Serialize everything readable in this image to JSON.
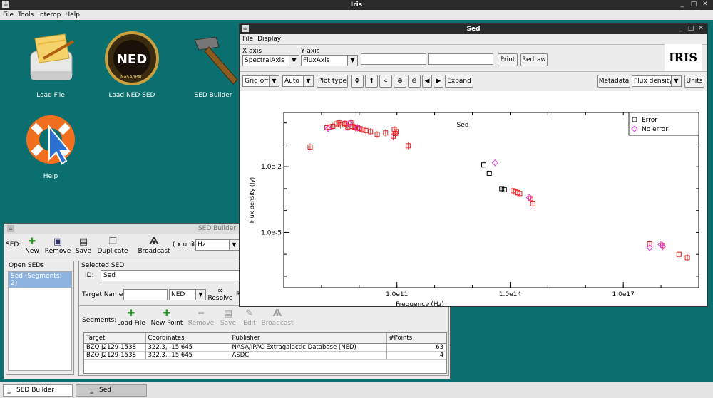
{
  "app": {
    "title": "Iris",
    "menu": [
      "File",
      "Tools",
      "Interop",
      "Help"
    ]
  },
  "desktop": {
    "icons": [
      {
        "label": "Load File"
      },
      {
        "label": "Load NED SED"
      },
      {
        "label": "SED Builder"
      },
      {
        "label": "Help"
      }
    ],
    "ned_text": "NED",
    "ned_ring": "NASA/IPAC"
  },
  "builder": {
    "title": "SED Builder",
    "sed_label": "SED:",
    "toolbar": [
      {
        "label": "New"
      },
      {
        "label": "Remove"
      },
      {
        "label": "Save"
      },
      {
        "label": "Duplicate"
      },
      {
        "label": "Broadcast"
      }
    ],
    "xunit_label": "( x unit",
    "xunit_value": "Hz",
    "open_seds_title": "Open SEDs",
    "open_seds": [
      "Sed (Segments: 2)"
    ],
    "selected_title": "Selected SED",
    "id_label": "ID:",
    "id_value": "Sed",
    "target_label": "Target Name:",
    "target_source": "NED",
    "resolve_label": "Resolve",
    "r_label": "R",
    "segments_label": "Segments:",
    "seg_toolbar": [
      {
        "label": "Load File"
      },
      {
        "label": "New Point"
      },
      {
        "label": "Remove"
      },
      {
        "label": "Save"
      },
      {
        "label": "Edit"
      },
      {
        "label": "Broadcast"
      }
    ],
    "table": {
      "headers": [
        "Target",
        "Coordinates",
        "Publisher",
        "#Points"
      ],
      "rows": [
        [
          "BZQ J2129-1538",
          "322.3, -15.645",
          "NASA/IPAC Extragalactic Database (NED)",
          "63"
        ],
        [
          "BZQ J2129-1538",
          "322.3, -15.645",
          "ASDC",
          "4"
        ]
      ]
    }
  },
  "sed": {
    "title": "Sed",
    "menu": [
      "File",
      "Display"
    ],
    "xaxis_label": "X axis",
    "xaxis_value": "SpectralAxis",
    "yaxis_label": "Y axis",
    "yaxis_value": "FluxAxis",
    "print_label": "Print",
    "redraw_label": "Redraw",
    "logo_text": "IRIS",
    "grid_value": "Grid off",
    "auto_value": "Auto",
    "plottype_label": "Plot type",
    "expand_label": "Expand",
    "metadata_label": "Metadata",
    "flux_value": "Flux density",
    "units_label": "Units"
  },
  "chart_data": {
    "type": "scatter",
    "title": "Sed",
    "xlabel": "Frequency (Hz)",
    "ylabel": "Flux density (Jy)",
    "xscale": "log",
    "yscale": "log",
    "xlim": [
      100000000.0,
      1e+19
    ],
    "ylim": [
      3e-08,
      3
    ],
    "xticks": [
      {
        "v": 100000000000.0,
        "label": "1.0e11"
      },
      {
        "v": 100000000000000.0,
        "label": "1.0e14"
      },
      {
        "v": 1e+17,
        "label": "1.0e17"
      }
    ],
    "yticks": [
      {
        "v": 0.01,
        "label": "1.0e-2"
      },
      {
        "v": 1e-05,
        "label": "1.0e-5"
      }
    ],
    "legend": {
      "placement": "top-right",
      "entries": [
        {
          "name": "Error",
          "marker": "square",
          "color": "#000000"
        },
        {
          "name": "No error",
          "marker": "diamond",
          "color": "#e040e0"
        }
      ]
    },
    "series": [
      {
        "name": "Error",
        "marker": "square",
        "color": "#e02020",
        "points": [
          [
            500000000.0,
            0.08
          ],
          [
            1400000000.0,
            0.6
          ],
          [
            1600000000.0,
            0.65
          ],
          [
            2000000000.0,
            0.7
          ],
          [
            2500000000.0,
            0.9
          ],
          [
            3000000000.0,
            1.0
          ],
          [
            3200000000.0,
            0.8
          ],
          [
            4200000000.0,
            0.95
          ],
          [
            4500000000.0,
            0.85
          ],
          [
            5000000000.0,
            0.65
          ],
          [
            6000000000.0,
            1.0
          ],
          [
            6500000000.0,
            0.7
          ],
          [
            7500000000.0,
            0.65
          ],
          [
            8000000000.0,
            0.6
          ],
          [
            9000000000.0,
            0.6
          ],
          [
            10000000000.0,
            0.55
          ],
          [
            12000000000.0,
            0.5
          ],
          [
            15000000000.0,
            0.45
          ],
          [
            20000000000.0,
            0.4
          ],
          [
            30000000000.0,
            0.3
          ],
          [
            50000000000.0,
            0.35
          ],
          [
            80000000000.0,
            0.25
          ],
          [
            85000000000.0,
            0.5
          ],
          [
            90000000000.0,
            0.33
          ],
          [
            95000000000.0,
            0.4
          ],
          [
            200000000000.0,
            0.09
          ],
          [
            120000000000000.0,
            0.0008
          ],
          [
            140000000000000.0,
            0.0007
          ],
          [
            160000000000000.0,
            0.00065
          ],
          [
            180000000000000.0,
            0.0006
          ],
          [
            350000000000000.0,
            0.00035
          ],
          [
            400000000000000.0,
            0.0002
          ],
          [
            5e+17,
            3e-06
          ],
          [
            1.1e+18,
            2.5e-06
          ],
          [
            3e+18,
            1e-06
          ],
          [
            5e+18,
            7e-07
          ]
        ]
      },
      {
        "name": "Error",
        "marker": "square",
        "color": "#000000",
        "points": [
          [
            20000000000000.0,
            0.012
          ],
          [
            28000000000000.0,
            0.005
          ],
          [
            60000000000000.0,
            0.001
          ],
          [
            70000000000000.0,
            0.0009
          ]
        ]
      },
      {
        "name": "No error",
        "marker": "diamond",
        "color": "#e040e0",
        "points": [
          [
            1500000000.0,
            0.55
          ],
          [
            5500000000.0,
            0.95
          ],
          [
            9000000000.0,
            0.6
          ],
          [
            40000000000000.0,
            0.015
          ],
          [
            320000000000000.0,
            0.0004
          ],
          [
            5e+17,
            2e-06
          ],
          [
            1e+18,
            2.8e-06
          ],
          [
            1.1e+18,
            2.2e-06
          ]
        ]
      }
    ]
  }
}
